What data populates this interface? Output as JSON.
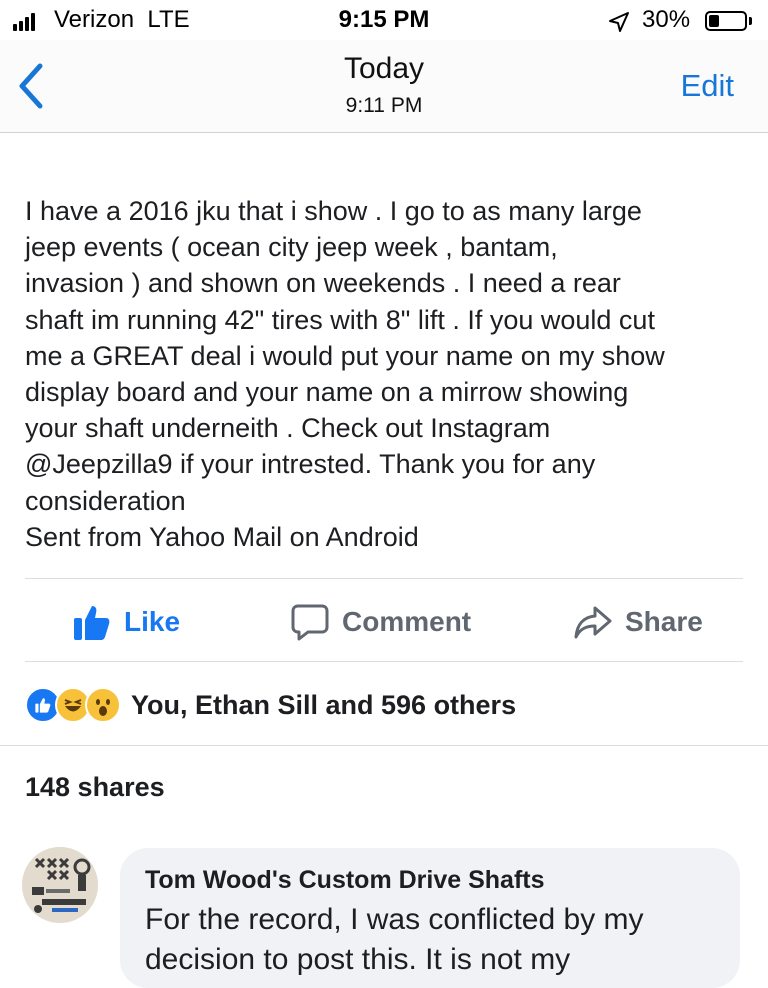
{
  "status_bar": {
    "carrier": "Verizon  LTE",
    "time": "9:15 PM",
    "battery_percent": "30%",
    "battery_level": 0.3
  },
  "nav": {
    "title": "Today",
    "subtitle": "9:11 PM",
    "edit_label": "Edit"
  },
  "post": {
    "text": "I have a 2016 jku that i show . I go to as many large\njeep events ( ocean city jeep week , bantam,\ninvasion ) and shown on weekends . I need a rear\nshaft im running 42\" tires with 8\" lift . If you would cut\nme a GREAT deal i would put your name on my show\ndisplay board and your name on a mirrow showing\nyour shaft underneith . Check out Instagram\n@Jeepzilla9 if your intrested. Thank you for any\nconsideration\nSent from Yahoo Mail on Android"
  },
  "actions": {
    "like_label": "Like",
    "comment_label": "Comment",
    "share_label": "Share"
  },
  "reactions": {
    "icons": [
      "like-reaction-icon",
      "haha-reaction-icon",
      "wow-reaction-icon"
    ],
    "summary": "You, Ethan Sill and 596 others"
  },
  "shares": {
    "label": "148 shares"
  },
  "comment": {
    "author": "Tom Wood's Custom Drive Shafts",
    "text": "For the record, I was conflicted by my decision to post this. It is not my"
  },
  "colors": {
    "accent": "#1877f2",
    "ios_blue": "#1877d6",
    "muted": "#606770",
    "bubble": "#f0f2f5"
  }
}
